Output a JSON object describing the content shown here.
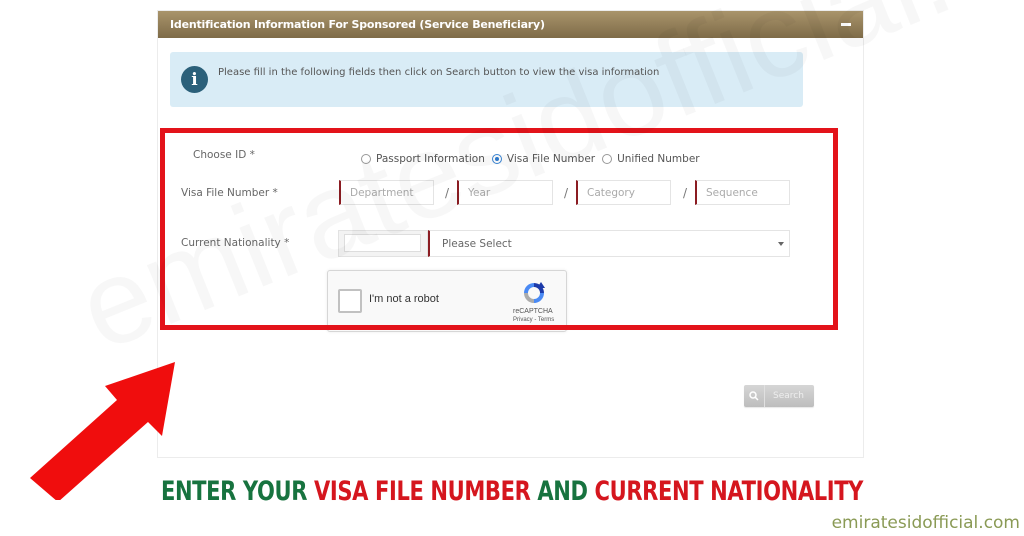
{
  "panel": {
    "title": "Identification Information For Sponsored (Service Beneficiary)",
    "collapse_icon": "minus-icon"
  },
  "info": {
    "icon": "info-icon",
    "icon_glyph": "i",
    "message": "Please fill in the following fields then click on Search button to view the visa information"
  },
  "form": {
    "choose_id": {
      "label": "Choose ID *",
      "options": [
        {
          "label": "Passport Information",
          "checked": false
        },
        {
          "label": "Visa File Number",
          "checked": true
        },
        {
          "label": "Unified Number",
          "checked": false
        }
      ]
    },
    "visa_file_number": {
      "label": "Visa File Number *",
      "separator": "/",
      "fields": [
        {
          "placeholder": "Department",
          "value": ""
        },
        {
          "placeholder": "Year",
          "value": ""
        },
        {
          "placeholder": "Category",
          "value": ""
        },
        {
          "placeholder": "Sequence",
          "value": ""
        }
      ]
    },
    "current_nationality": {
      "label": "Current Nationality *",
      "code_value": "",
      "selected": "Please Select"
    },
    "captcha": {
      "label": "I'm not a robot",
      "brand": "reCAPTCHA",
      "links": "Privacy - Terms",
      "checked": false
    },
    "search_button": {
      "label": "Search",
      "icon": "search-icon"
    }
  },
  "annotation": {
    "caption_parts": [
      {
        "text": "ENTER YOUR ",
        "color": "green"
      },
      {
        "text": "VISA FILE NUMBER",
        "color": "red"
      },
      {
        "text": " AND ",
        "color": "green"
      },
      {
        "text": "CURRENT NATIONALITY",
        "color": "red"
      }
    ],
    "site": "emiratesidofficial.com",
    "watermark": "emiratesidofficial.com",
    "colors": {
      "green": "#17733f",
      "red": "#d5161e",
      "frame": "#e3131a",
      "header": "#8f7b55"
    }
  }
}
